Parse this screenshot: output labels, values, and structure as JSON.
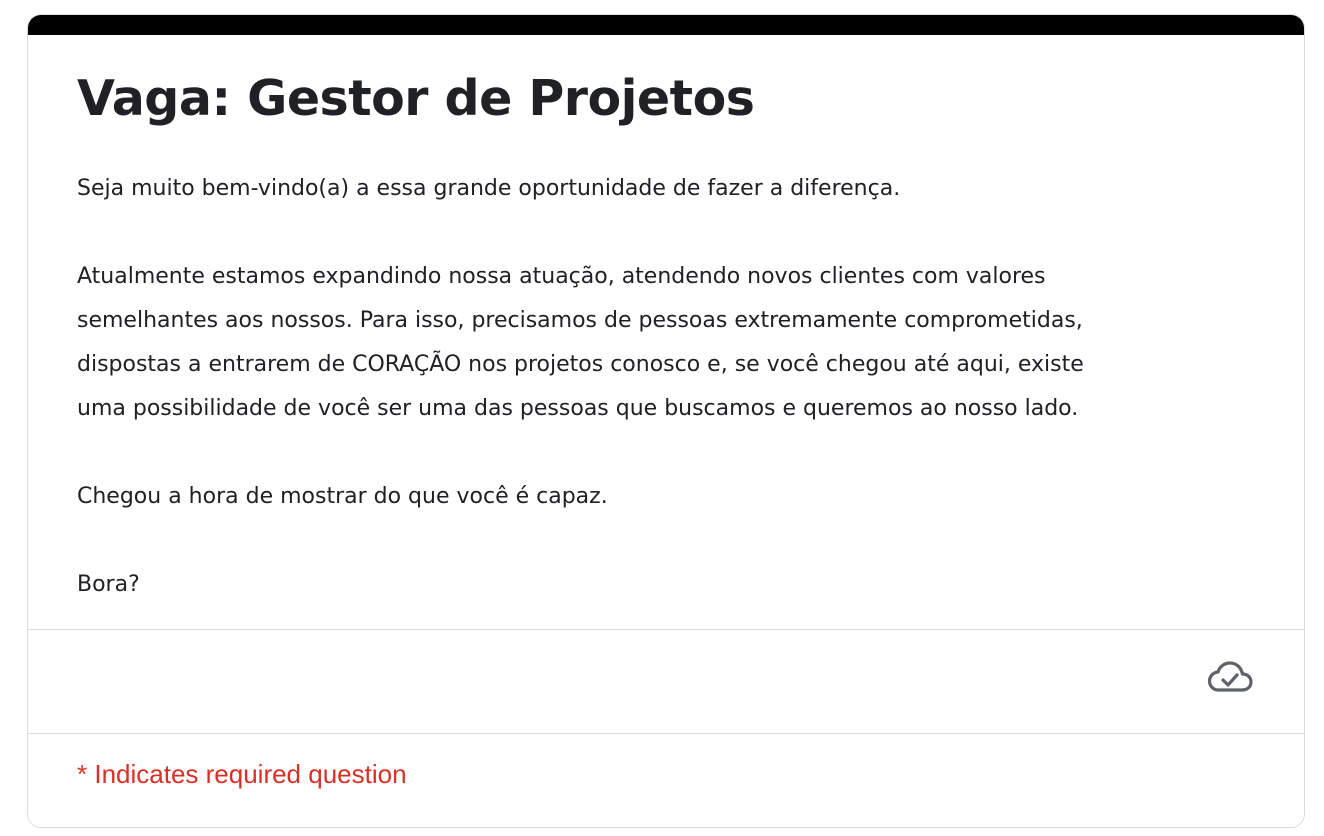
{
  "form": {
    "accent_color": "#000000",
    "title": "Vaga: Gestor de Projetos",
    "description": {
      "p1": "Seja muito bem-vindo(a) a essa grande oportunidade de fazer a diferença.",
      "p2_line1": "Atualmente estamos expandindo nossa atuação, atendendo novos clientes com valores",
      "p2_line2": "semelhantes aos nossos. Para isso, precisamos de pessoas extremamente comprometidas,",
      "p2_line3": "dispostas a entrarem de CORAÇÃO nos projetos conosco e, se você chegou até aqui, existe",
      "p2_line4": "uma possibilidade de você ser uma das pessoas que buscamos e queremos ao nosso lado.",
      "p3": "Chegou a hora de mostrar do que você é capaz.",
      "p4": "Bora?"
    },
    "save_status_icon": "cloud-check-icon",
    "required_note": "* Indicates required question",
    "required_color": "#d93025"
  }
}
